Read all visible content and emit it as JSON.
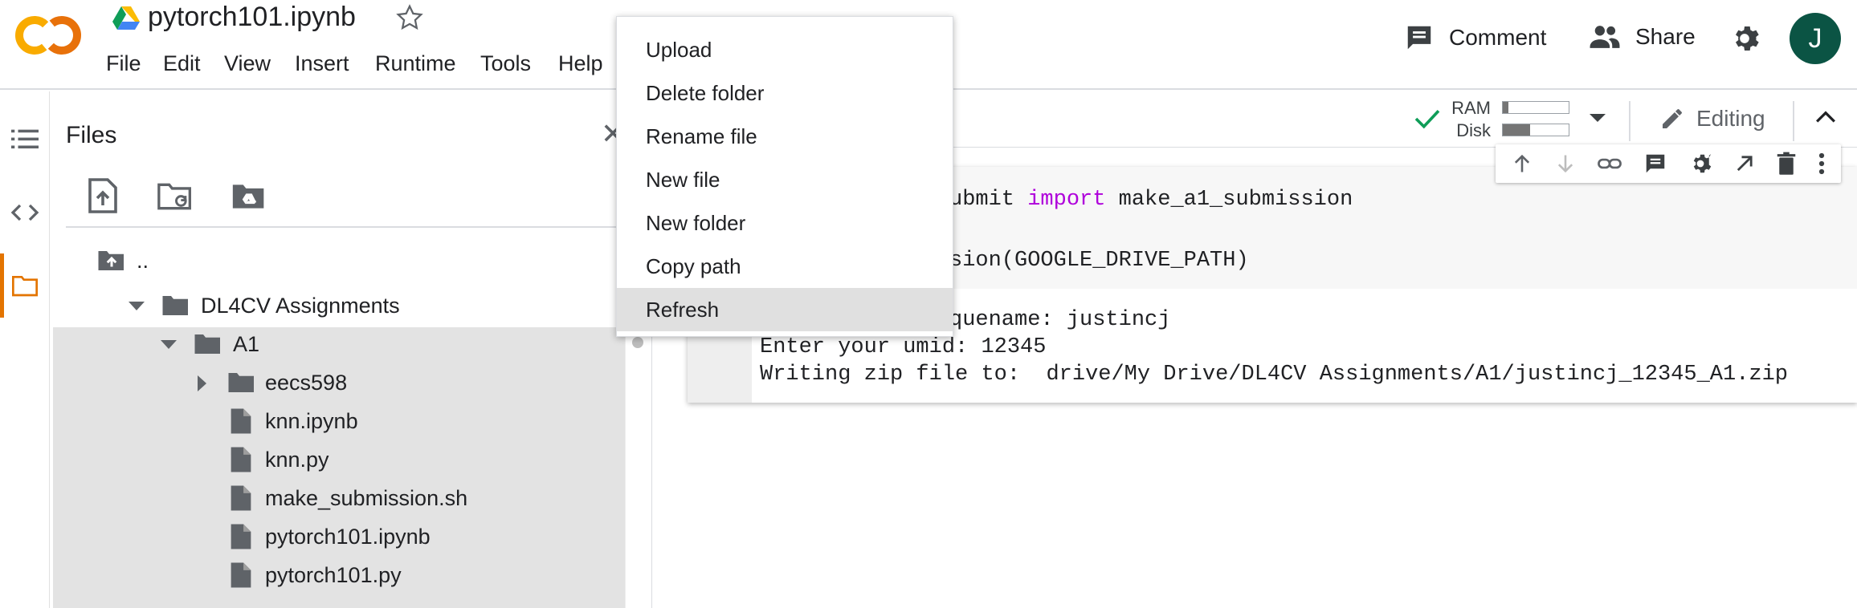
{
  "header": {
    "notebook_title": "pytorch101.ipynb",
    "menu": [
      "File",
      "Edit",
      "View",
      "Insert",
      "Runtime",
      "Tools",
      "Help"
    ],
    "comment_label": "Comment",
    "share_label": "Share",
    "avatar_initial": "J",
    "avatar_color": "#0b5444"
  },
  "files_panel": {
    "title": "Files",
    "close_glyph": "✕",
    "tree": {
      "parent": "..",
      "root_folder": "DL4CV Assignments",
      "subfolder": "A1",
      "items": [
        "eecs598",
        "knn.ipynb",
        "knn.py",
        "make_submission.sh",
        "pytorch101.ipynb",
        "pytorch101.py"
      ]
    }
  },
  "resources": {
    "ram_label": "RAM",
    "disk_label": "Disk",
    "ram_usage": 0.08,
    "disk_usage": 0.42,
    "editing_label": "Editing",
    "check_color": "#0f9d58"
  },
  "cell": {
    "code_line1_suffix": "ubmit",
    "code_line1_keyword": "import",
    "code_line1_rest": "make_a1_submission",
    "code_line2": "sion(GOOGLE_DRIVE_PATH)",
    "output_line1": "quename: justincj",
    "output_line2": "Enter your umid: 12345",
    "output_line3": "Writing zip file to:  drive/My Drive/DL4CV Assignments/A1/justincj_12345_A1.zip"
  },
  "context_menu": {
    "items": [
      "Upload",
      "Delete folder",
      "Rename file",
      "New file",
      "New folder",
      "Copy path",
      "Refresh"
    ],
    "active_index": 6
  },
  "icons": {
    "logo": "colab-logo",
    "drive": "drive-icon",
    "star": "star-icon",
    "rail": [
      "toc-icon",
      "code-icon",
      "folder-icon"
    ]
  }
}
